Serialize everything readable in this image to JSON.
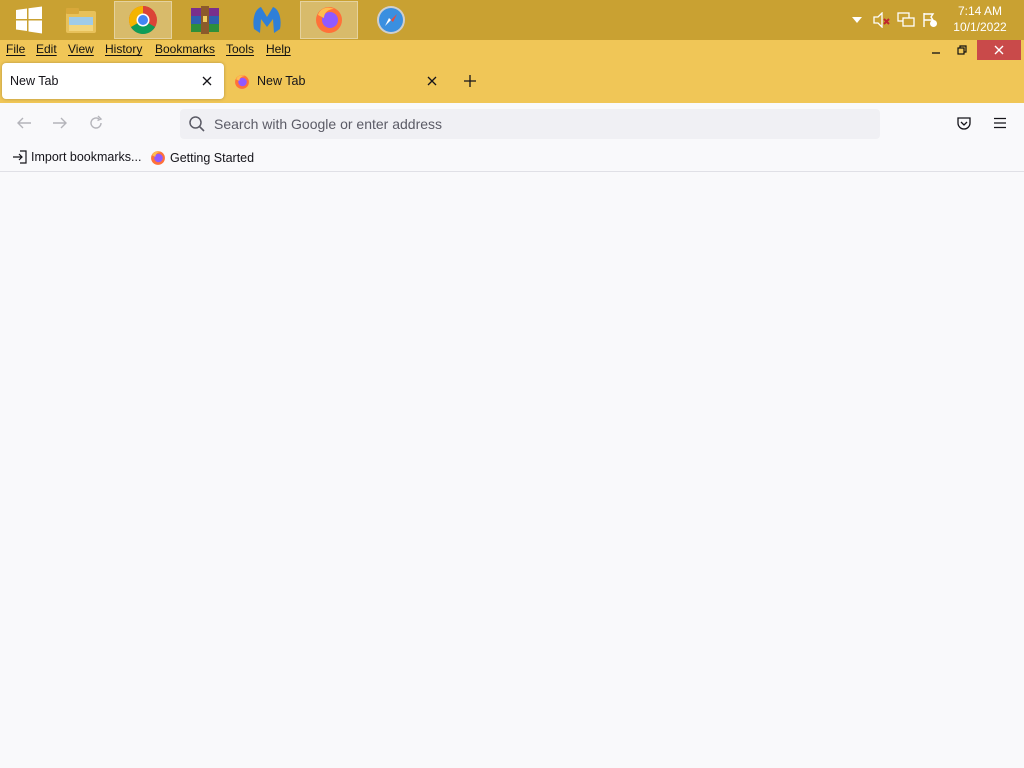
{
  "taskbar": {
    "apps": [
      {
        "name": "start",
        "icon": "windows-logo-icon"
      },
      {
        "name": "file-explorer",
        "icon": "file-explorer-icon"
      },
      {
        "name": "chrome",
        "icon": "chrome-icon"
      },
      {
        "name": "winrar",
        "icon": "winrar-icon"
      },
      {
        "name": "malwarebytes",
        "icon": "malwarebytes-icon"
      },
      {
        "name": "firefox",
        "icon": "firefox-icon"
      },
      {
        "name": "safari",
        "icon": "safari-icon"
      }
    ],
    "tray_icons": [
      "show-hidden-icons-icon",
      "volume-muted-icon",
      "network-icon",
      "action-center-icon"
    ],
    "clock": {
      "time": "7:14 AM",
      "date": "10/1/2022"
    },
    "color": "#c9a132"
  },
  "menubar": {
    "items": [
      "File",
      "Edit",
      "View",
      "History",
      "Bookmarks",
      "Tools",
      "Help"
    ],
    "color": "#f0c657"
  },
  "tabs": [
    {
      "label": "New Tab",
      "selected": true
    },
    {
      "label": "New Tab",
      "selected": false,
      "icon": "firefox-icon"
    }
  ],
  "navbar": {
    "search_placeholder": "Search with Google or enter address"
  },
  "bookmarks": [
    {
      "label": "Import bookmarks...",
      "icon": "import-icon"
    },
    {
      "label": "Getting Started",
      "icon": "firefox-icon"
    }
  ],
  "colors": {
    "close_button": "#c94a4a",
    "page_background": "#f9f9fb"
  }
}
